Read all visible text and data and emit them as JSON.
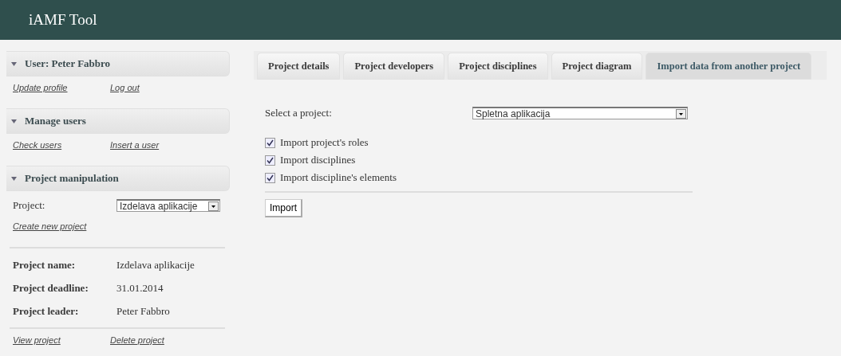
{
  "header": {
    "title": "iAMF Tool"
  },
  "sidebar": {
    "sections": [
      {
        "title": "User: Peter Fabbro",
        "expanded": true,
        "links": [
          "Update profile",
          "Log out"
        ]
      },
      {
        "title": "Manage users",
        "expanded": true,
        "links": [
          "Check users",
          "Insert a user"
        ]
      },
      {
        "title": "Project manipulation",
        "expanded": true,
        "project_label": "Project:",
        "project_value": "Izdelava aplikacije",
        "create_link": "Create new project",
        "details": [
          {
            "label": "Project name:",
            "value": "Izdelava aplikacije"
          },
          {
            "label": "Project deadline:",
            "value": "31.01.2014"
          },
          {
            "label": "Project leader:",
            "value": "Peter Fabbro"
          }
        ],
        "links": [
          "View project",
          "Delete project"
        ]
      }
    ]
  },
  "tabs": [
    {
      "label": "Project details",
      "selected": false
    },
    {
      "label": "Project developers",
      "selected": false
    },
    {
      "label": "Project disciplines",
      "selected": false
    },
    {
      "label": "Project diagram",
      "selected": false
    },
    {
      "label": "Import data from another project",
      "selected": true
    }
  ],
  "form": {
    "select_label": "Select a project:",
    "select_value": "Spletna aplikacija",
    "options": [
      {
        "label": "Import project's roles",
        "checked": true
      },
      {
        "label": "Import disciplines",
        "checked": true
      },
      {
        "label": "Import discipline's elements",
        "checked": true
      }
    ],
    "button": "Import"
  }
}
